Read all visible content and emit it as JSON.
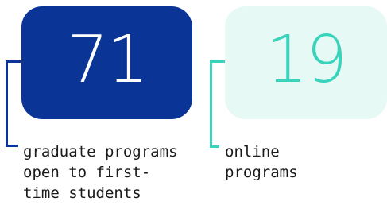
{
  "stats": [
    {
      "number": "71",
      "caption": "graduate programs open to first-time students",
      "caption_lines": [
        "graduate programs",
        "open to first-",
        "time students"
      ]
    },
    {
      "number": "19",
      "caption": "online programs",
      "caption_lines": [
        "online",
        "programs"
      ]
    }
  ],
  "colors": {
    "navy": "#0a3597",
    "teal": "#39d3bc",
    "mint_background": "#e6f9f5",
    "text": "#1a1a1a"
  }
}
